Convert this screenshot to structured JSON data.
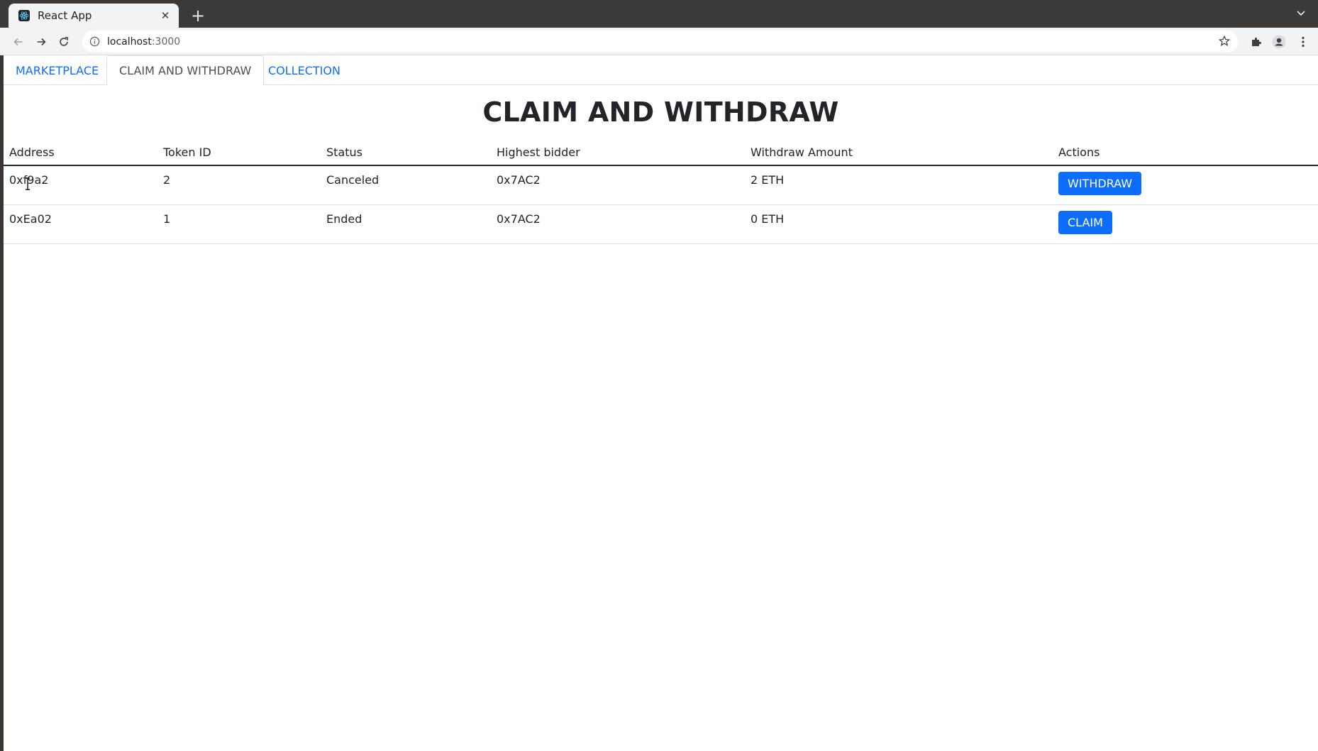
{
  "browser": {
    "tab_title": "React App",
    "url_host": "localhost",
    "url_port": ":3000"
  },
  "nav": {
    "tabs": [
      {
        "label": "MARKETPLACE"
      },
      {
        "label": "CLAIM AND WITHDRAW"
      },
      {
        "label": "COLLECTION"
      }
    ]
  },
  "page": {
    "title": "CLAIM AND WITHDRAW"
  },
  "table": {
    "headers": [
      "Address",
      "Token ID",
      "Status",
      "Highest bidder",
      "Withdraw Amount",
      "Actions"
    ],
    "rows": [
      {
        "address": "0xf9a2",
        "token_id": "2",
        "status": "Canceled",
        "highest_bidder": "0x7AC2",
        "withdraw_amount": "2 ETH",
        "action": "WITHDRAW"
      },
      {
        "address": "0xEa02",
        "token_id": "1",
        "status": "Ended",
        "highest_bidder": "0x7AC2",
        "withdraw_amount": "0 ETH",
        "action": "CLAIM"
      }
    ]
  },
  "colors": {
    "primary": "#0d6efd",
    "link": "#0d6efd",
    "text": "#212529"
  }
}
